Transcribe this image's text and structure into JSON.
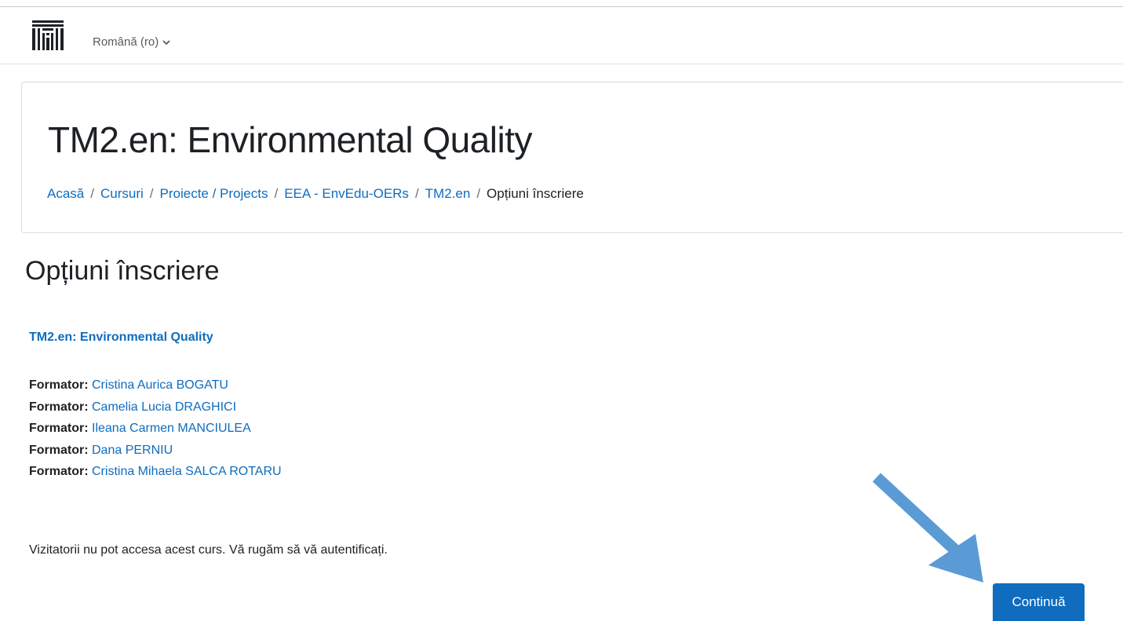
{
  "navbar": {
    "logo_icon": "moodle-institution-logo-icon",
    "language_label": "Română (ro)",
    "language_chevron_icon": "chevron-down-icon"
  },
  "header": {
    "course_title": "TM2.en: Environmental Quality",
    "breadcrumb": [
      {
        "label": "Acasă",
        "link": true
      },
      {
        "label": "Cursuri",
        "link": true
      },
      {
        "label": "Proiecte / Projects",
        "link": true
      },
      {
        "label": "EEA - EnvEdu-OERs",
        "link": true
      },
      {
        "label": "TM2.en",
        "link": true
      },
      {
        "label": "Opțiuni înscriere",
        "link": false
      }
    ],
    "breadcrumb_separator": "/"
  },
  "main": {
    "section_title": "Opțiuni înscriere",
    "course_link": "TM2.en: Environmental Quality",
    "teachers": [
      {
        "role": "Formator:",
        "name": "Cristina Aurica BOGATU"
      },
      {
        "role": "Formator:",
        "name": "Camelia Lucia DRAGHICI"
      },
      {
        "role": "Formator:",
        "name": "Ileana Carmen MANCIULEA"
      },
      {
        "role": "Formator:",
        "name": "Dana PERNIU"
      },
      {
        "role": "Formator:",
        "name": "Cristina Mihaela SALCA ROTARU"
      }
    ],
    "guest_notice": "Vizitatorii nu pot accesa acest curs. Vă rugăm să vă autentificați.",
    "continue_label": "Continuă"
  },
  "colors": {
    "link": "#0f6cbf",
    "primary_button": "#0f6cbf",
    "annotation_arrow": "#5b9bd5"
  }
}
